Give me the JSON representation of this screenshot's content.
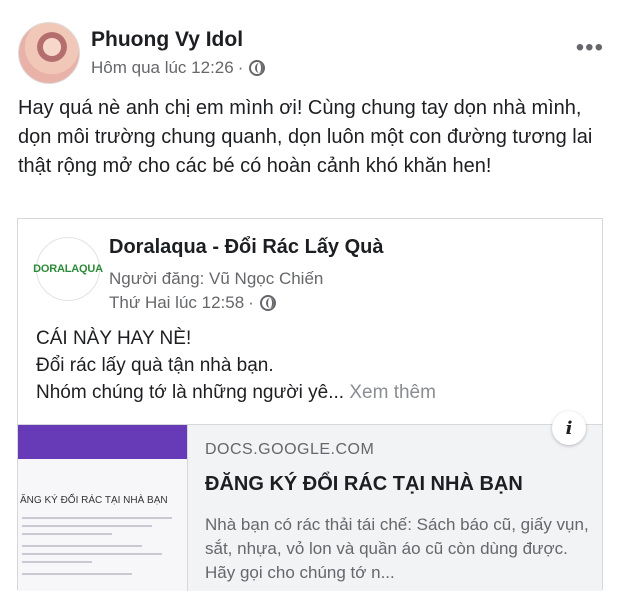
{
  "post": {
    "author": "Phuong Vy Idol",
    "time": "Hôm qua lúc 12:26",
    "separator": "·",
    "text": "Hay quá nè anh chị em mình ơi! Cùng chung tay dọn nhà mình, dọn môi trường chung quanh, dọn luôn một con đường tương lai thật rộng mở cho các bé có hoàn cảnh khó khăn hen!",
    "more_icon": "•••"
  },
  "shared": {
    "page_name": "Doralaqua - Đổi Rác Lấy Quà",
    "avatar_text": "DORALAQUA",
    "poster": "Người đăng: Vũ Ngọc Chiến",
    "time": "Thứ Hai lúc 12:58",
    "separator": "·",
    "lines": [
      "CÁI NÀY HAY NÈ!",
      "Đổi rác lấy quà tận nhà bạn.",
      "Nhóm chúng tớ là những người yê..."
    ],
    "see_more": "Xem thêm"
  },
  "link": {
    "domain": "DOCS.GOOGLE.COM",
    "title": "ĐĂNG KÝ ĐỔI RÁC TẠI NHÀ BẠN",
    "description": "Nhà bạn có rác thải tái chế: Sách báo cũ, giấy vụn, sắt, nhựa, vỏ lon và quần áo cũ còn dùng được. Hãy gọi cho chúng tớ n...",
    "thumb_title": "ĂNG KÝ ĐỔI RÁC TẠI NHÀ BẠN",
    "info_icon": "i"
  },
  "colors": {
    "text": "#1c1e21",
    "muted": "#65676b",
    "form_accent": "#673ab7"
  }
}
